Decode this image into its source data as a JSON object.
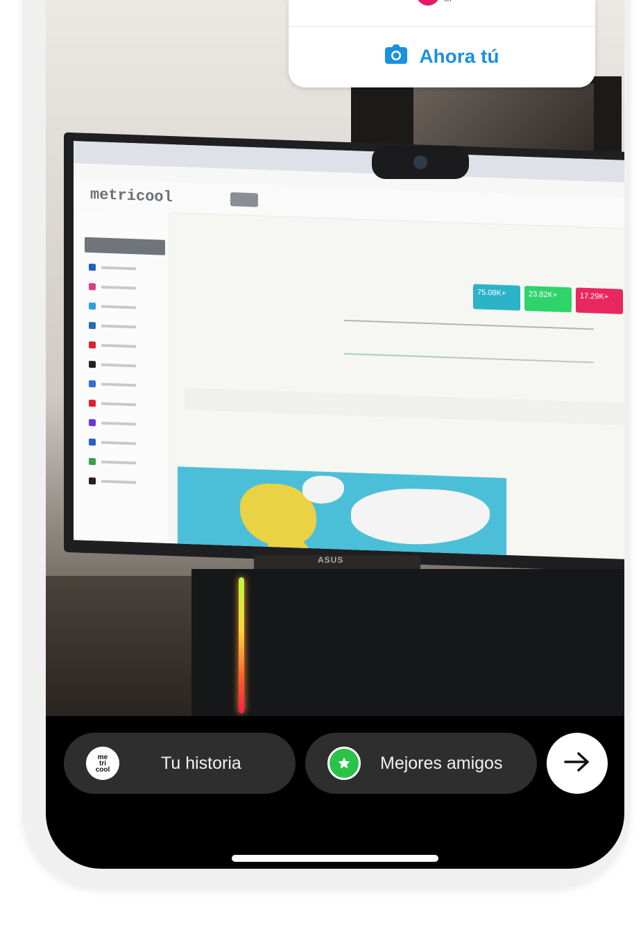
{
  "notification": {
    "action_label": "Ahora tú",
    "icon": "camera-icon",
    "accent_color": "#1b8fe0",
    "badge_text": "ter"
  },
  "photo": {
    "monitor_brand_text": "metricool",
    "stand_logo_text": "ASUS",
    "kpis": [
      {
        "label": "75.08K+",
        "color": "#2bb3c8"
      },
      {
        "label": "23.82K+",
        "color": "#2fd36b"
      },
      {
        "label": "17.29K+",
        "color": "#e9275f"
      }
    ]
  },
  "share_bar": {
    "your_story": {
      "label": "Tu historia",
      "avatar_text": [
        "me",
        "tri",
        "cool"
      ],
      "icon": "avatar-icon"
    },
    "close_friends": {
      "label": "Mejores amigos",
      "icon": "star-icon",
      "color": "#29c34a"
    },
    "next_icon": "arrow-right-icon"
  }
}
